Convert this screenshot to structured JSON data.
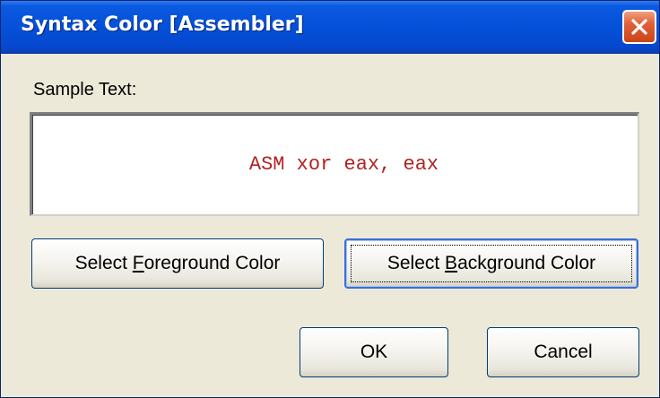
{
  "window": {
    "title": "Syntax Color [Assembler]"
  },
  "titlebar": {
    "close_icon": "close-icon"
  },
  "sample": {
    "label": "Sample Text:",
    "text": "ASM xor eax, eax",
    "text_color": "#b22222",
    "background_color": "#ffffff"
  },
  "buttons": {
    "foreground": {
      "prefix": "Select ",
      "mnemonic": "F",
      "suffix": "oreground Color"
    },
    "background": {
      "prefix": "Select ",
      "mnemonic": "B",
      "suffix": "ackground Color"
    },
    "ok": "OK",
    "cancel": "Cancel"
  },
  "colors": {
    "titlebar": "#0550d8",
    "dialog_face": "#ece9d8",
    "close_button": "#e0603a"
  }
}
